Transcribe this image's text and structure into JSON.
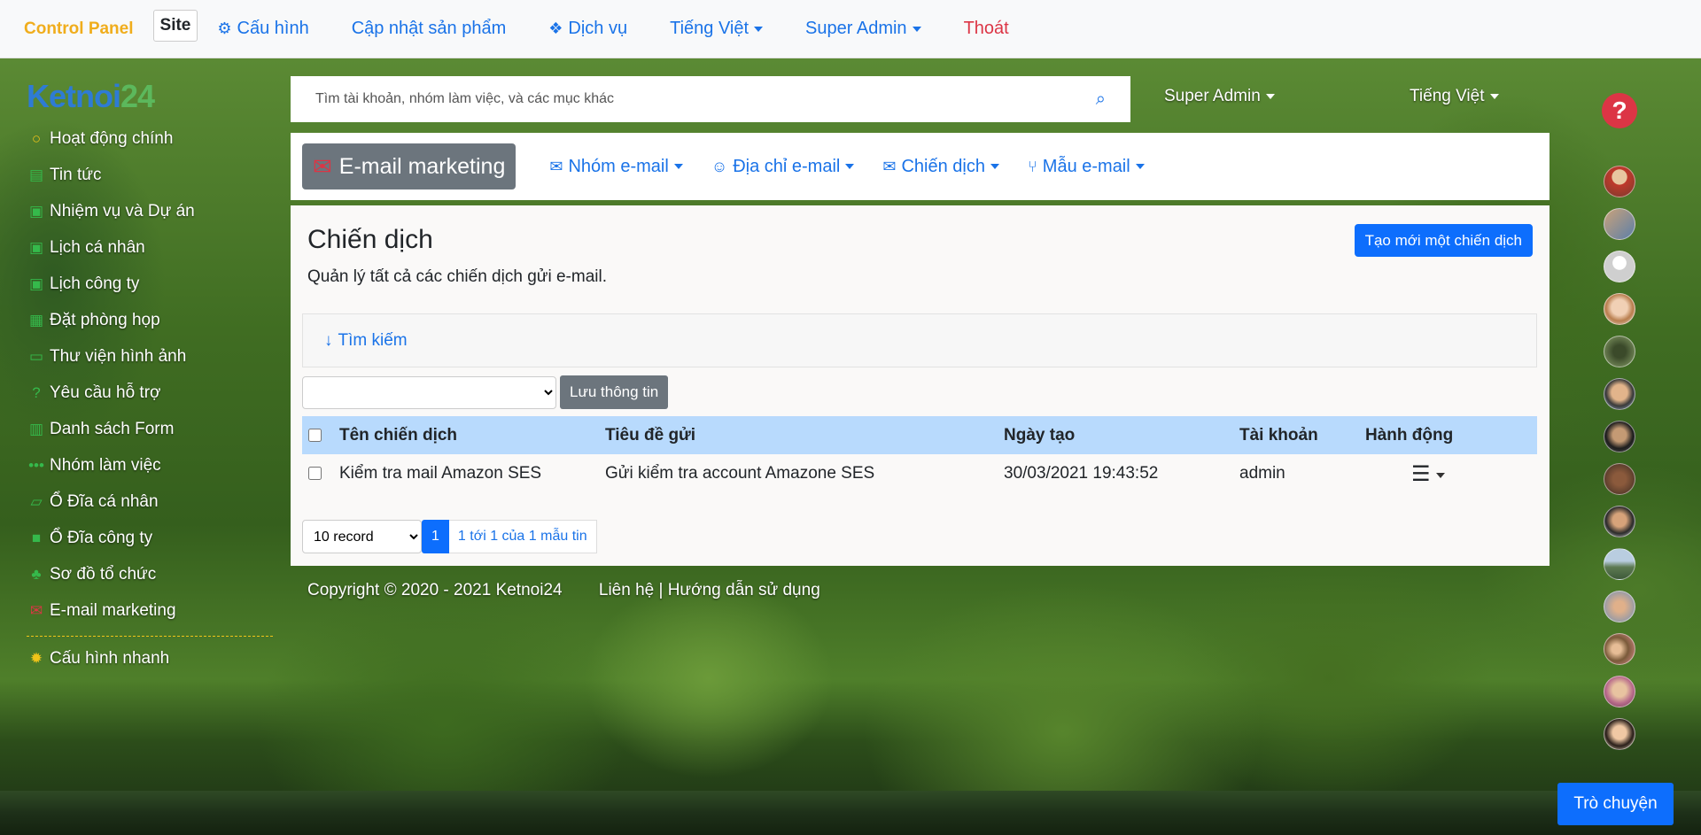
{
  "topbar": {
    "brand": "Control Panel",
    "site": "Site",
    "items": [
      {
        "label": "Cấu hình",
        "icon": "gears-icon"
      },
      {
        "label": "Cập nhật sản phẩm"
      },
      {
        "label": "Dịch vụ",
        "icon": "cubes-icon"
      },
      {
        "label": "Tiếng Việt"
      },
      {
        "label": "Super Admin"
      },
      {
        "label": "Thoát"
      }
    ]
  },
  "logo": {
    "part1": "Ketnoi",
    "part2": "24"
  },
  "sidebar": {
    "items": [
      {
        "label": "Hoạt động chính",
        "icon": "circle-icon"
      },
      {
        "label": "Tin tức",
        "icon": "newspaper-icon"
      },
      {
        "label": "Nhiệm vụ và Dự án",
        "icon": "calendar-plus-icon"
      },
      {
        "label": "Lịch cá nhân",
        "icon": "calendar-plus-icon"
      },
      {
        "label": "Lịch công ty",
        "icon": "calendar-plus-icon"
      },
      {
        "label": "Đặt phòng họp",
        "icon": "calendar-icon"
      },
      {
        "label": "Thư viện hình ảnh",
        "icon": "image-icon"
      },
      {
        "label": "Yêu cầu hỗ trợ",
        "icon": "question-circle-icon"
      },
      {
        "label": "Danh sách Form",
        "icon": "form-icon"
      },
      {
        "label": "Nhóm làm việc",
        "icon": "dots-icon"
      },
      {
        "label": "Ổ Đĩa cá nhân",
        "icon": "folder-open-icon"
      },
      {
        "label": "Ổ Đĩa công ty",
        "icon": "folder-icon"
      },
      {
        "label": "Sơ đồ tổ chức",
        "icon": "sitemap-icon"
      },
      {
        "label": "E-mail marketing",
        "icon": "envelope-icon"
      }
    ],
    "quick": {
      "label": "Cấu hình nhanh",
      "icon": "gear-icon"
    }
  },
  "search": {
    "placeholder": "Tìm tài khoản, nhóm làm việc, và các mục khác"
  },
  "header_right": {
    "user": "Super Admin",
    "language": "Tiếng Việt"
  },
  "module": {
    "title": "E-mail marketing",
    "nav": [
      {
        "label": "Nhóm e-mail",
        "icon": "group-mail-icon"
      },
      {
        "label": "Địa chỉ e-mail",
        "icon": "address-icon"
      },
      {
        "label": "Chiến dịch",
        "icon": "envelope-outline-icon"
      },
      {
        "label": "Mẫu e-mail",
        "icon": "fork-icon"
      }
    ]
  },
  "page": {
    "title": "Chiến dịch",
    "description": "Quản lý tất cả các chiến dịch gửi e-mail.",
    "new_button": "Tạo mới một chiến dịch",
    "search_toggle": "Tìm kiếm",
    "save_button": "Lưu thông tin"
  },
  "table": {
    "headers": [
      "Tên chiến dịch",
      "Tiêu đề gửi",
      "Ngày tạo",
      "Tài khoản",
      "Hành động"
    ],
    "rows": [
      [
        "Kiểm tra mail Amazon SES",
        "Gửi kiểm tra account Amazone SES",
        "30/03/2021 19:43:52",
        "admin"
      ]
    ]
  },
  "pager": {
    "page_size": "10 record",
    "current_page": "1",
    "info": "1 tới 1 của 1 mẫu tin"
  },
  "footer": {
    "copyright": "Copyright © 2020 - 2021 Ketnoi24",
    "links": "Liên hệ | Hướng dẫn sử dụng"
  },
  "help": "?",
  "chat": "Trò chuyện",
  "colors": {
    "brand": "#f0ad1c",
    "link": "#1a73e8",
    "primary": "#0d6efd",
    "danger": "#dc3545",
    "header_row": "#b8dafd"
  }
}
